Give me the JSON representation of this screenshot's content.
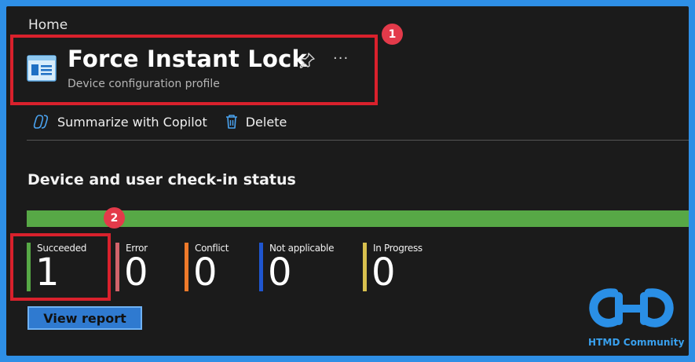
{
  "breadcrumb": "Home",
  "header": {
    "title": "Force Instant Lock",
    "subtitle": "Device configuration profile",
    "more": "···"
  },
  "toolbar": {
    "copilot_label": "Summarize with Copilot",
    "delete_label": "Delete"
  },
  "annotations": {
    "badge1": "1",
    "badge2": "2"
  },
  "section": {
    "title": "Device and user check-in status"
  },
  "status": [
    {
      "label": "Succeeded",
      "value": "1",
      "color": "#57a846"
    },
    {
      "label": "Error",
      "value": "0",
      "color": "#d1636b"
    },
    {
      "label": "Conflict",
      "value": "0",
      "color": "#ef7a2a"
    },
    {
      "label": "Not applicable",
      "value": "0",
      "color": "#1f56d0"
    },
    {
      "label": "In Progress",
      "value": "0",
      "color": "#d8c04e"
    }
  ],
  "view_report_label": "View report",
  "watermark": {
    "text": "HTMD Community"
  },
  "colors": {
    "accent": "#2e8fe6",
    "annotation": "#d9212c",
    "bar": "#57a846"
  }
}
